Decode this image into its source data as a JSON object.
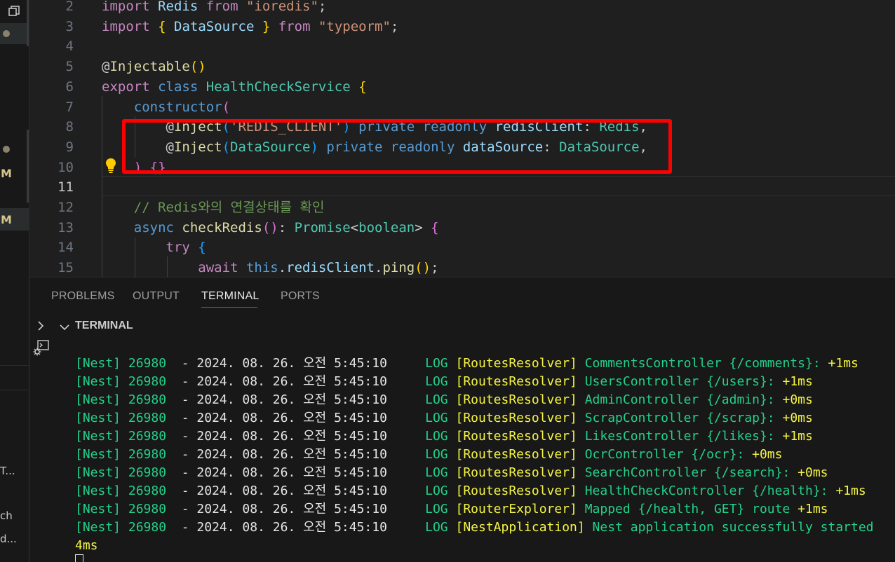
{
  "left_strip": {
    "badges": [
      "M",
      "M"
    ],
    "snippets": [
      "T...",
      "ch",
      "d..."
    ]
  },
  "editor": {
    "lines": [
      {
        "n": "2",
        "tokens": [
          [
            "kw",
            "import"
          ],
          [
            "pl",
            " "
          ],
          [
            "var",
            "Redis"
          ],
          [
            "pl",
            " "
          ],
          [
            "kw",
            "from"
          ],
          [
            "pl",
            " "
          ],
          [
            "str",
            "\"ioredis\""
          ],
          [
            "pl",
            ";"
          ]
        ]
      },
      {
        "n": "3",
        "tokens": [
          [
            "kw",
            "import"
          ],
          [
            "pl",
            " "
          ],
          [
            "br1",
            "{"
          ],
          [
            "pl",
            " "
          ],
          [
            "var",
            "DataSource"
          ],
          [
            "pl",
            " "
          ],
          [
            "br1",
            "}"
          ],
          [
            "pl",
            " "
          ],
          [
            "kw",
            "from"
          ],
          [
            "pl",
            " "
          ],
          [
            "str",
            "\"typeorm\""
          ],
          [
            "pl",
            ";"
          ]
        ]
      },
      {
        "n": "4",
        "tokens": []
      },
      {
        "n": "5",
        "tokens": [
          [
            "pl",
            "@"
          ],
          [
            "fn",
            "Injectable"
          ],
          [
            "br1",
            "()"
          ]
        ]
      },
      {
        "n": "6",
        "tokens": [
          [
            "kw",
            "export"
          ],
          [
            "pl",
            " "
          ],
          [
            "st",
            "class"
          ],
          [
            "pl",
            " "
          ],
          [
            "cl",
            "HealthCheckService"
          ],
          [
            "pl",
            " "
          ],
          [
            "br1",
            "{"
          ]
        ]
      },
      {
        "n": "7",
        "tokens": [
          [
            "pl",
            "    "
          ],
          [
            "st",
            "constructor"
          ],
          [
            "br2",
            "("
          ]
        ]
      },
      {
        "n": "8",
        "tokens": [
          [
            "pl",
            "        @"
          ],
          [
            "fn",
            "Inject"
          ],
          [
            "br3",
            "("
          ],
          [
            "str",
            "'REDIS_CLIENT'"
          ],
          [
            "br3",
            ")"
          ],
          [
            "pl",
            " "
          ],
          [
            "st",
            "private"
          ],
          [
            "pl",
            " "
          ],
          [
            "st",
            "readonly"
          ],
          [
            "pl",
            " "
          ],
          [
            "var",
            "redisClient"
          ],
          [
            "pl",
            ": "
          ],
          [
            "cl",
            "Redis"
          ],
          [
            "pl",
            ","
          ]
        ]
      },
      {
        "n": "9",
        "tokens": [
          [
            "pl",
            "        @"
          ],
          [
            "fn",
            "Inject"
          ],
          [
            "br3",
            "("
          ],
          [
            "cl",
            "DataSource"
          ],
          [
            "br3",
            ")"
          ],
          [
            "pl",
            " "
          ],
          [
            "st",
            "private"
          ],
          [
            "pl",
            " "
          ],
          [
            "st",
            "readonly"
          ],
          [
            "pl",
            " "
          ],
          [
            "var",
            "dataSource"
          ],
          [
            "pl",
            ": "
          ],
          [
            "cl",
            "DataSource"
          ],
          [
            "pl",
            ","
          ]
        ]
      },
      {
        "n": "10",
        "tokens": [
          [
            "pl",
            "    "
          ],
          [
            "br2",
            ")"
          ],
          [
            "pl",
            " "
          ],
          [
            "br2",
            "{}"
          ]
        ]
      },
      {
        "n": "11",
        "tokens": []
      },
      {
        "n": "12",
        "tokens": [
          [
            "pl",
            "    "
          ],
          [
            "cm",
            "// Redis와의 연결상태를 확인"
          ]
        ]
      },
      {
        "n": "13",
        "tokens": [
          [
            "pl",
            "    "
          ],
          [
            "st",
            "async"
          ],
          [
            "pl",
            " "
          ],
          [
            "fn",
            "checkRedis"
          ],
          [
            "br2",
            "()"
          ],
          [
            "pl",
            ": "
          ],
          [
            "cl",
            "Promise"
          ],
          [
            "pl",
            "<"
          ],
          [
            "cl",
            "boolean"
          ],
          [
            "pl",
            "> "
          ],
          [
            "br2",
            "{"
          ]
        ]
      },
      {
        "n": "14",
        "tokens": [
          [
            "pl",
            "        "
          ],
          [
            "kw",
            "try"
          ],
          [
            "pl",
            " "
          ],
          [
            "br3",
            "{"
          ]
        ]
      },
      {
        "n": "15",
        "tokens": [
          [
            "pl",
            "            "
          ],
          [
            "kw",
            "await"
          ],
          [
            "pl",
            " "
          ],
          [
            "st",
            "this"
          ],
          [
            "pl",
            "."
          ],
          [
            "var",
            "redisClient"
          ],
          [
            "pl",
            "."
          ],
          [
            "fn",
            "ping"
          ],
          [
            "br1",
            "()"
          ],
          [
            "pl",
            ";"
          ]
        ]
      }
    ],
    "active_line": "11"
  },
  "panel": {
    "tabs": [
      "PROBLEMS",
      "OUTPUT",
      "TERMINAL",
      "PORTS"
    ],
    "active_tab": "TERMINAL",
    "section_title": "TERMINAL"
  },
  "terminal": {
    "lines": [
      {
        "nest": "[Nest] 26980",
        "date": "  - 2024. 08. 26. 오전 5:45:10",
        "log": "     LOG ",
        "ctx": "[RoutesResolver]",
        "msg": " CommentsController {/comments}:",
        "time": " +1ms"
      },
      {
        "nest": "[Nest] 26980",
        "date": "  - 2024. 08. 26. 오전 5:45:10",
        "log": "     LOG ",
        "ctx": "[RoutesResolver]",
        "msg": " UsersController {/users}:",
        "time": " +1ms"
      },
      {
        "nest": "[Nest] 26980",
        "date": "  - 2024. 08. 26. 오전 5:45:10",
        "log": "     LOG ",
        "ctx": "[RoutesResolver]",
        "msg": " AdminController {/admin}:",
        "time": " +0ms"
      },
      {
        "nest": "[Nest] 26980",
        "date": "  - 2024. 08. 26. 오전 5:45:10",
        "log": "     LOG ",
        "ctx": "[RoutesResolver]",
        "msg": " ScrapController {/scrap}:",
        "time": " +0ms"
      },
      {
        "nest": "[Nest] 26980",
        "date": "  - 2024. 08. 26. 오전 5:45:10",
        "log": "     LOG ",
        "ctx": "[RoutesResolver]",
        "msg": " LikesController {/likes}:",
        "time": " +1ms"
      },
      {
        "nest": "[Nest] 26980",
        "date": "  - 2024. 08. 26. 오전 5:45:10",
        "log": "     LOG ",
        "ctx": "[RoutesResolver]",
        "msg": " OcrController {/ocr}:",
        "time": " +0ms"
      },
      {
        "nest": "[Nest] 26980",
        "date": "  - 2024. 08. 26. 오전 5:45:10",
        "log": "     LOG ",
        "ctx": "[RoutesResolver]",
        "msg": " SearchController {/search}:",
        "time": " +0ms"
      },
      {
        "nest": "[Nest] 26980",
        "date": "  - 2024. 08. 26. 오전 5:45:10",
        "log": "     LOG ",
        "ctx": "[RoutesResolver]",
        "msg": " HealthCheckController {/health}:",
        "time": " +1ms"
      },
      {
        "nest": "[Nest] 26980",
        "date": "  - 2024. 08. 26. 오전 5:45:10",
        "log": "     LOG ",
        "ctx": "[RouterExplorer]",
        "msg": " Mapped {/health, GET} route",
        "time": " +1ms"
      },
      {
        "nest": "[Nest] 26980",
        "date": "  - 2024. 08. 26. 오전 5:45:10",
        "log": "     LOG ",
        "ctx": "[NestApplication]",
        "msg": " Nest application successfully started",
        "time": ""
      }
    ],
    "wrap_tail": "4ms"
  },
  "icons": {
    "restore": "restore-window-icon",
    "bulb": "lightbulb-icon",
    "chevron_right": "chevron-right-icon",
    "chevron_down": "chevron-down-icon",
    "new_terminal": "terminal-settings-icon"
  },
  "colors": {
    "editor_bg": "#1f1f1f",
    "panel_bg": "#181818",
    "highlight_border": "#ff0000",
    "active_tab_underline": "#0078d4",
    "terminal_green": "#23d18b",
    "terminal_yellow": "#f5f543"
  }
}
